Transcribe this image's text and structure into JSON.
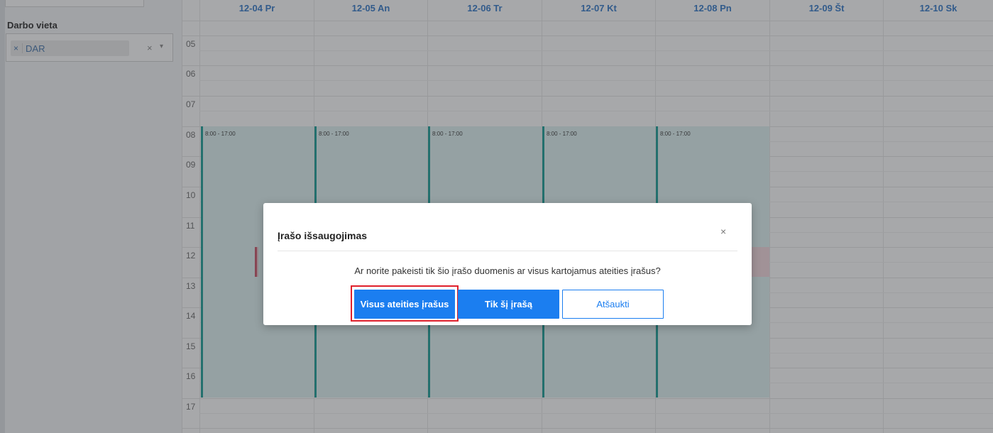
{
  "sidebar": {
    "filter_label": "Darbo vieta",
    "selected_chip": "DAR",
    "chip_remove_symbol": "×",
    "clear_symbol": "×",
    "arrow_symbol": "▾"
  },
  "calendar": {
    "days": [
      "12-04 Pr",
      "12-05 An",
      "12-06 Tr",
      "12-07 Kt",
      "12-08 Pn",
      "12-09 Št",
      "12-10 Sk"
    ],
    "hours": [
      "05",
      "06",
      "07",
      "08",
      "09",
      "10",
      "11",
      "12",
      "13",
      "14",
      "15",
      "16",
      "17"
    ],
    "event_time": "8:00 - 17:00",
    "event_color": "#0f9a92"
  },
  "modal": {
    "title": "Įrašo išsaugojimas",
    "close_symbol": "×",
    "message": "Ar norite pakeisti tik šio įrašo duomenis ar visus kartojamus ateities įrašus?",
    "buttons": {
      "all_future": "Visus ateities įrašus",
      "only_this": "Tik šį įrašą",
      "cancel": "Atšaukti"
    },
    "primary_color": "#1b7ef0",
    "highlight_color": "#e0202b"
  }
}
